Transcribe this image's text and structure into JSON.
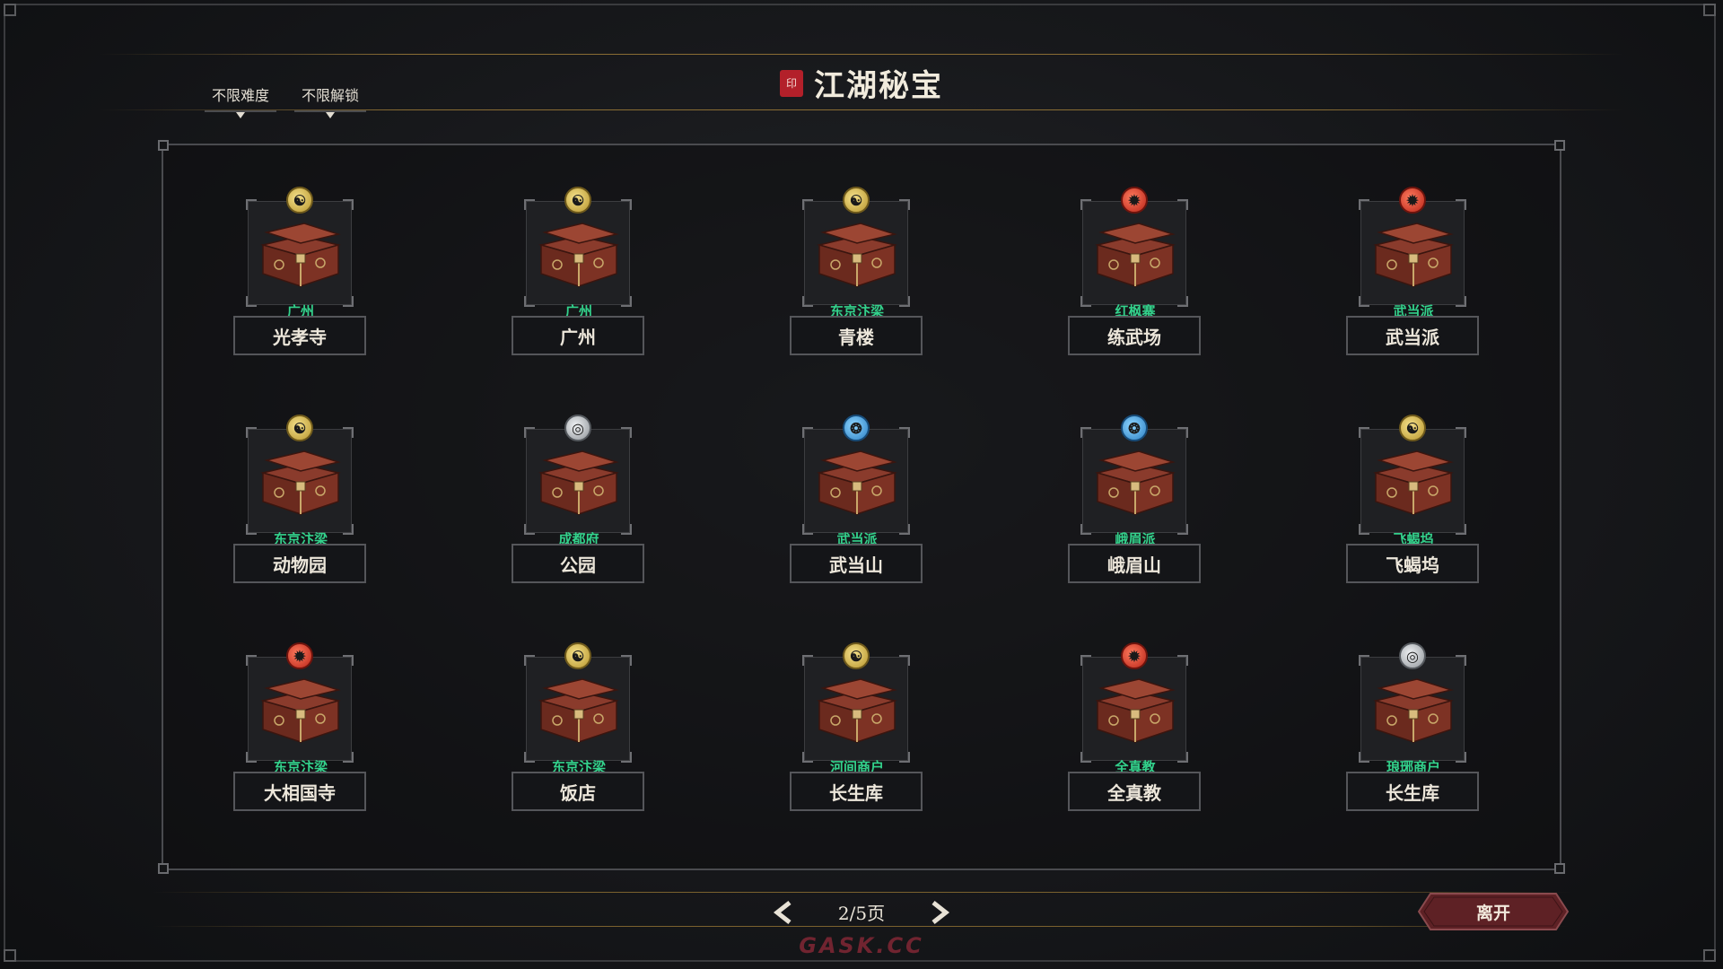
{
  "header": {
    "title": "江湖秘宝",
    "seal_text": "印"
  },
  "filters": [
    {
      "label": "不限难度",
      "icon": "dropdown-caret-icon"
    },
    {
      "label": "不限解锁",
      "icon": "dropdown-caret-icon"
    }
  ],
  "rarity_colors": {
    "gold": "#d4b24a",
    "red": "#d8392a",
    "blue": "#4aa6e6",
    "silver": "#c3c7cc"
  },
  "treasures": [
    {
      "region": "广州",
      "name": "光孝寺",
      "rarity": "gold"
    },
    {
      "region": "广州",
      "name": "广州",
      "rarity": "gold"
    },
    {
      "region": "东京汴梁",
      "name": "青楼",
      "rarity": "gold"
    },
    {
      "region": "红枫寨",
      "name": "练武场",
      "rarity": "red"
    },
    {
      "region": "武当派",
      "name": "武当派",
      "rarity": "red"
    },
    {
      "region": "东京汴梁",
      "name": "动物园",
      "rarity": "gold"
    },
    {
      "region": "成都府",
      "name": "公园",
      "rarity": "silver"
    },
    {
      "region": "武当派",
      "name": "武当山",
      "rarity": "blue"
    },
    {
      "region": "峨眉派",
      "name": "峨眉山",
      "rarity": "blue"
    },
    {
      "region": "飞蝎坞",
      "name": "飞蝎坞",
      "rarity": "gold"
    },
    {
      "region": "东京汴梁",
      "name": "大相国寺",
      "rarity": "red"
    },
    {
      "region": "东京汴梁",
      "name": "饭店",
      "rarity": "gold"
    },
    {
      "region": "河间商户",
      "name": "长生库",
      "rarity": "gold"
    },
    {
      "region": "全真教",
      "name": "全真教",
      "rarity": "red"
    },
    {
      "region": "琅琊商户",
      "name": "长生库",
      "rarity": "silver"
    }
  ],
  "pagination": {
    "label": "2/5页",
    "current": 2,
    "total": 5,
    "prev_icon": "chevron-left-icon",
    "next_icon": "chevron-right-icon"
  },
  "leave_button": {
    "label": "离开"
  },
  "watermark": "GASK.CC"
}
